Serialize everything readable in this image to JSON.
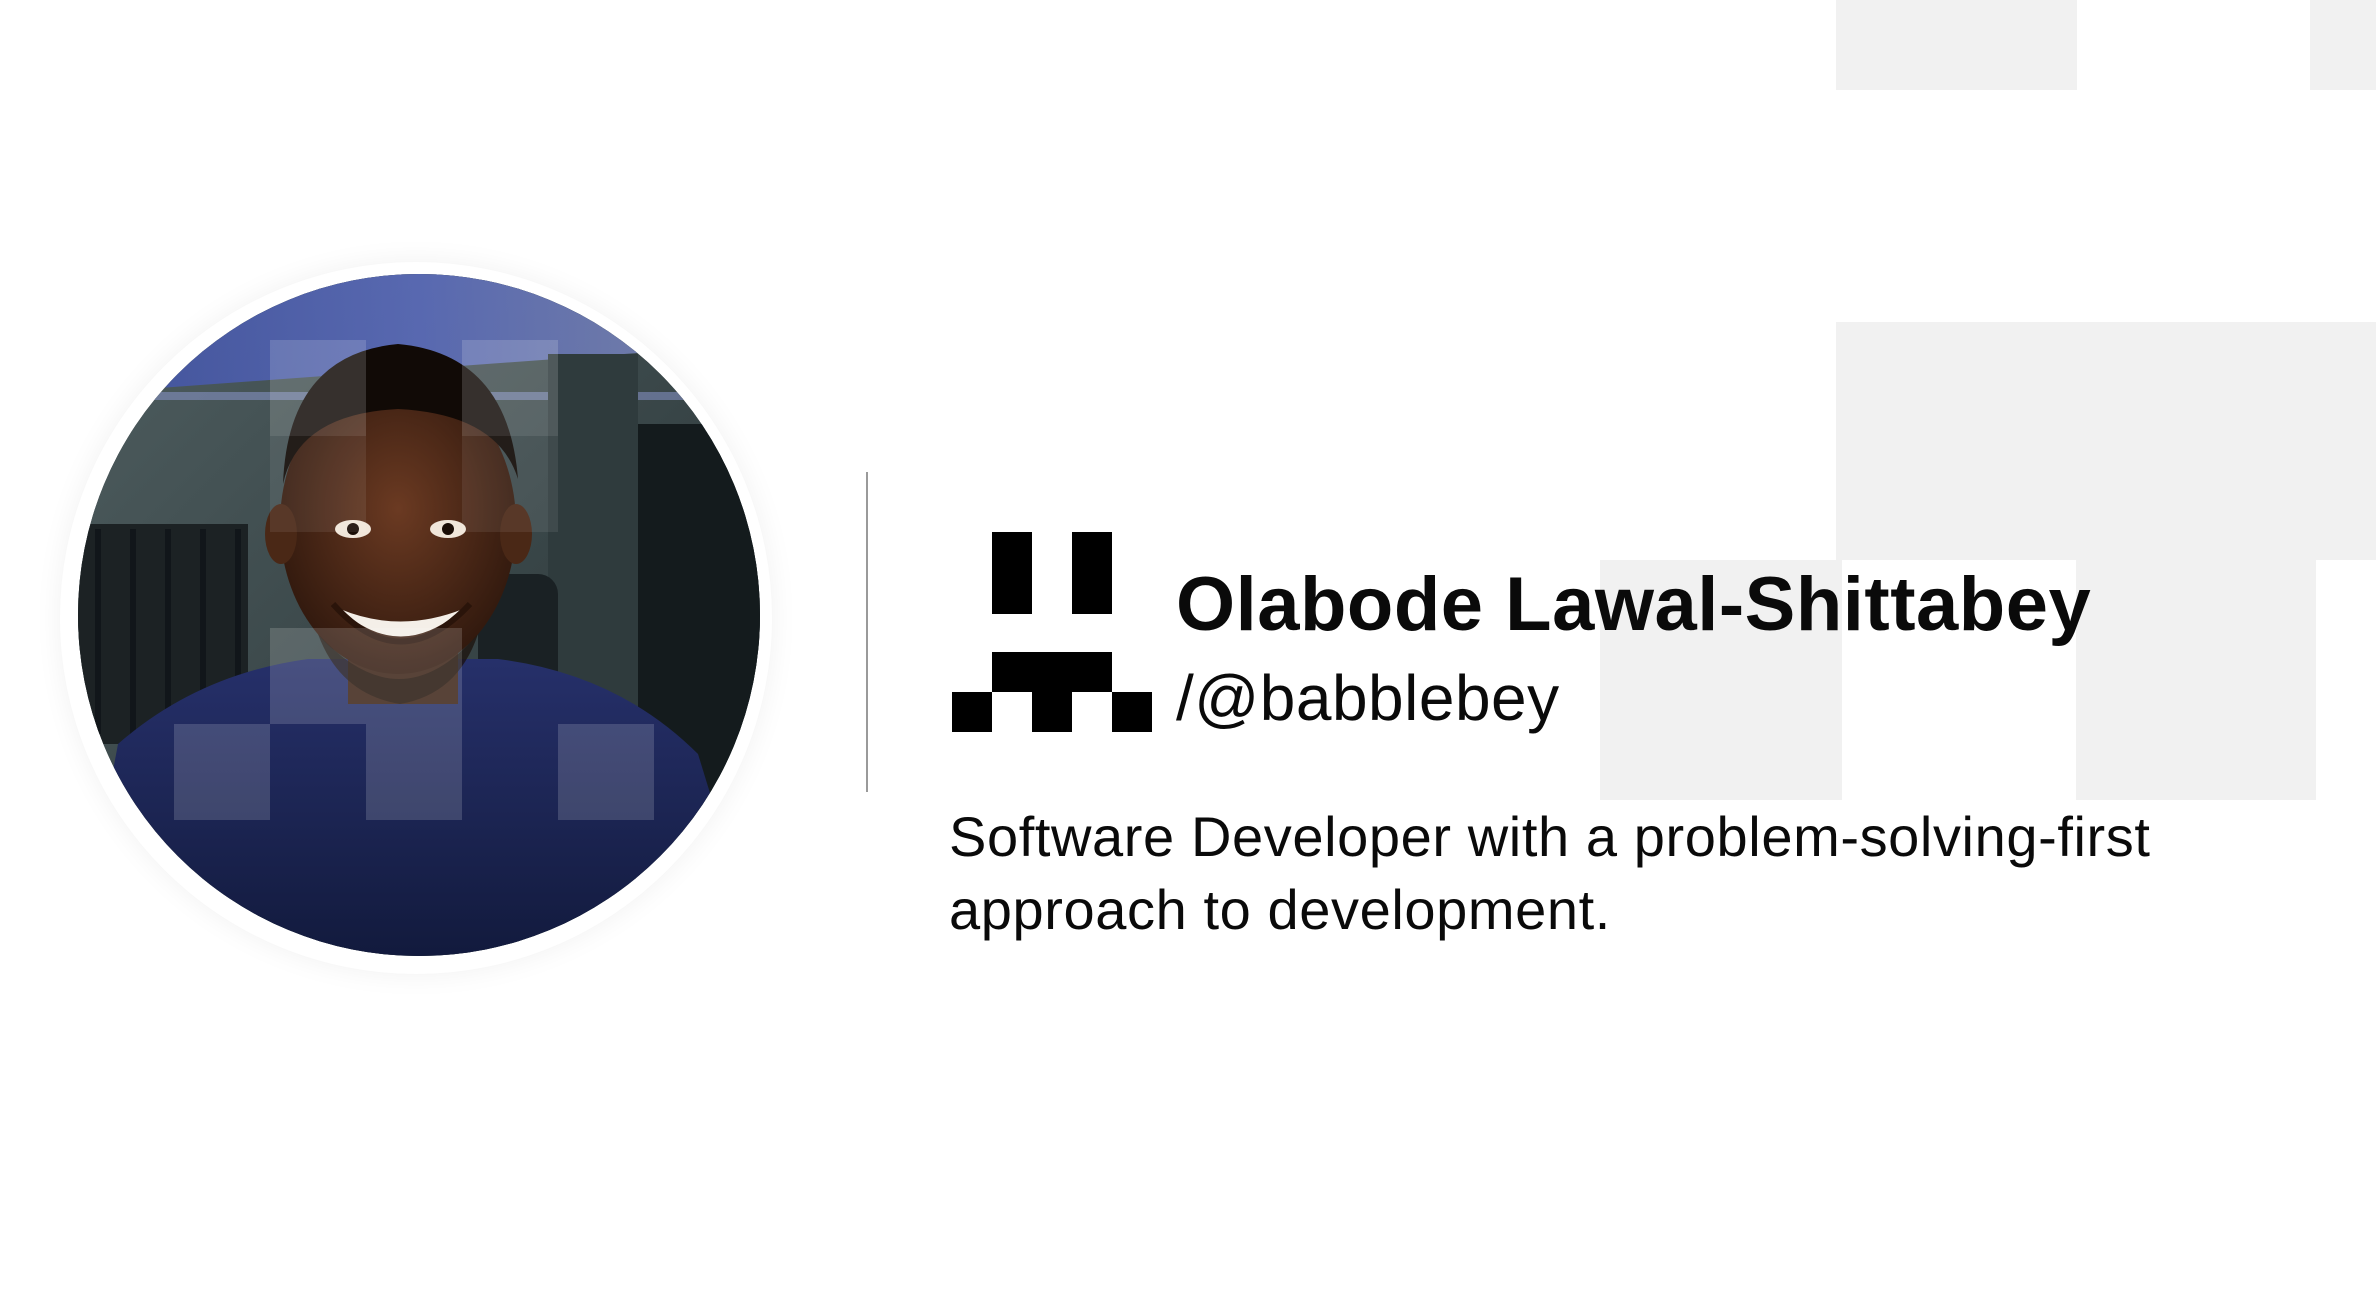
{
  "profile": {
    "name": "Olabode Lawal-Shittabey",
    "handle": "/@babblebey",
    "bio": "Software Developer with a problem-solving-first approach to development."
  },
  "colors": {
    "background": "#ffffff",
    "accent_blocks": "#f1f1f1",
    "text": "#0a0a0a",
    "divider": "#9a9a9a",
    "sweater": "#1f2a5c"
  },
  "icons": {
    "logo": "pixel-face-logo",
    "avatar": "profile-photo"
  }
}
